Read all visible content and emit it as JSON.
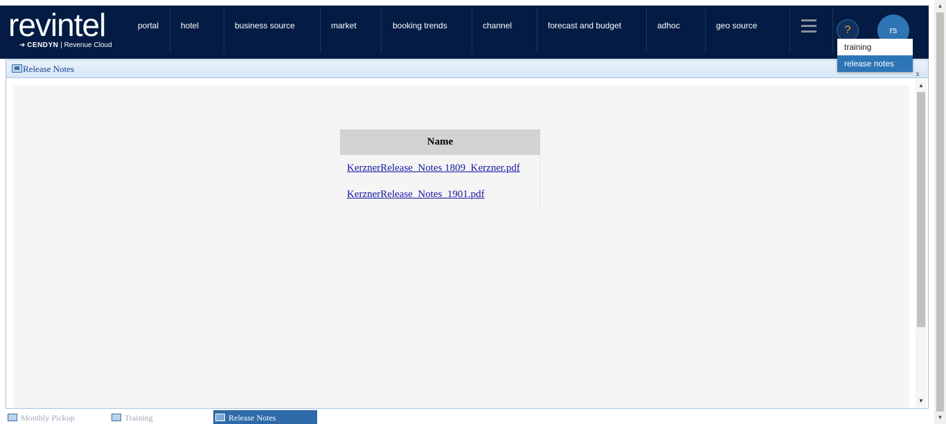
{
  "logo": {
    "word_bold": "rev",
    "word_thin": "intel",
    "sub_brand": "CENDYN",
    "sub_separator": "|",
    "sub_product": "Revenue Cloud"
  },
  "nav": {
    "items": [
      "portal",
      "hotel",
      "business source",
      "market",
      "booking trends",
      "channel",
      "forecast and budget",
      "adhoc",
      "geo source"
    ]
  },
  "help": {
    "icon_label": "?"
  },
  "user": {
    "initials": "rs"
  },
  "help_menu": {
    "items": [
      "training",
      "release notes"
    ],
    "active": "release notes"
  },
  "window": {
    "title": "Release Notes",
    "close_label": "x"
  },
  "files": {
    "header": "Name",
    "rows": [
      "KerznerRelease_Notes 1809_Kerzner.pdf",
      "KerznerRelease_Notes_1901.pdf"
    ]
  },
  "taskbar": {
    "tabs": [
      "Monthly Pickup",
      "Training",
      "Release Notes"
    ],
    "active": "Release Notes"
  },
  "colors": {
    "navbar": "#041c44",
    "accent": "#2e75b6",
    "link": "#1515a3",
    "window_border": "#a5c4e6"
  }
}
